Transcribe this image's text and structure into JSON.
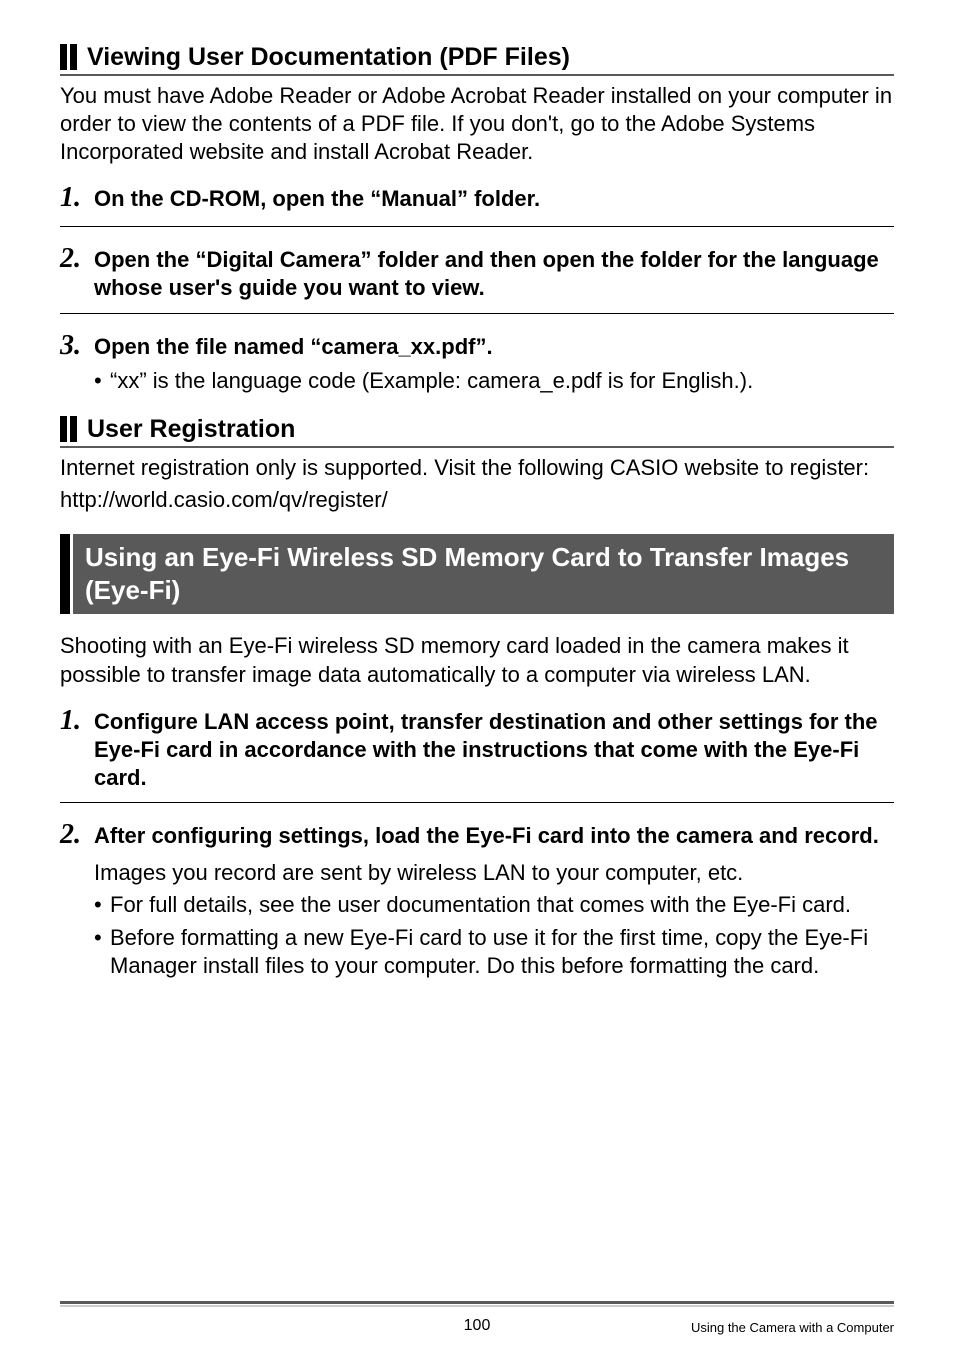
{
  "section1": {
    "title": "Viewing User Documentation (PDF Files)",
    "intro": "You must have Adobe Reader or Adobe Acrobat Reader installed on your computer in order to view the contents of a PDF file. If you don't, go to the Adobe Systems Incorporated website and install Acrobat Reader.",
    "steps": [
      {
        "num": "1.",
        "text": "On the CD-ROM, open the “Manual” folder."
      },
      {
        "num": "2.",
        "text": "Open the “Digital Camera” folder and then open the folder for the language whose user's guide you want to view."
      },
      {
        "num": "3.",
        "text": "Open the file named “camera_xx.pdf”."
      }
    ],
    "step3_bullet": "“xx” is the language code (Example: camera_e.pdf is for English.)."
  },
  "section2": {
    "title": "User Registration",
    "body1": "Internet registration only is supported. Visit the following CASIO website to register:",
    "body2": "http://world.casio.com/qv/register/"
  },
  "bigheading": "Using an Eye-Fi Wireless SD Memory Card to Transfer Images (Eye-Fi)",
  "section3": {
    "intro": "Shooting with an Eye-Fi wireless SD memory card loaded in the camera makes it possible to transfer image data automatically to a computer via wireless LAN.",
    "steps": [
      {
        "num": "1.",
        "text": "Configure LAN access point, transfer destination and other settings for the Eye-Fi card in accordance with the instructions that come with the Eye-Fi card."
      },
      {
        "num": "2.",
        "text": "After configuring settings, load the Eye-Fi card into the camera and record."
      }
    ],
    "after2": "Images you record are sent by wireless LAN to your computer, etc.",
    "after2_bullets": [
      "For full details, see the user documentation that comes with the Eye-Fi card.",
      "Before formatting a new Eye-Fi card to use it for the first time, copy the Eye-Fi Manager install files to your computer. Do this before formatting the card."
    ]
  },
  "footer": {
    "page": "100",
    "label": "Using the Camera with a Computer"
  }
}
